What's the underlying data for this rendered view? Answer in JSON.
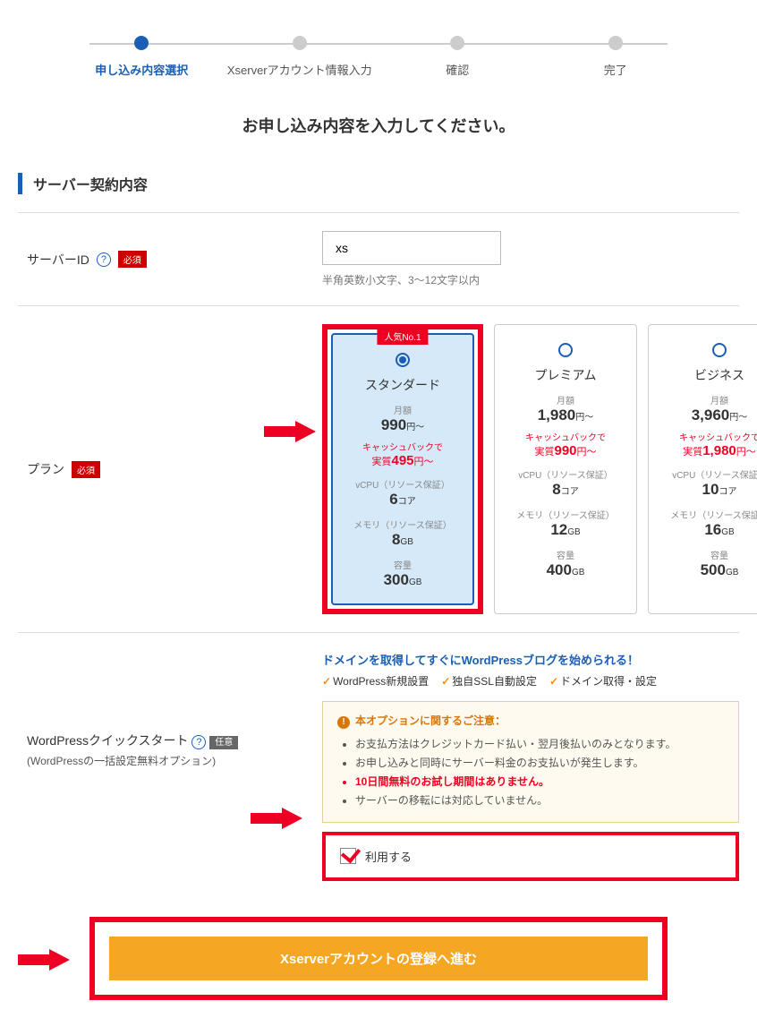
{
  "stepper": {
    "steps": [
      {
        "label": "申し込み内容選択",
        "active": true
      },
      {
        "label": "Xserverアカウント情報入力",
        "active": false
      },
      {
        "label": "確認",
        "active": false
      },
      {
        "label": "完了",
        "active": false
      }
    ]
  },
  "page_subtitle": "お申し込み内容を入力してください。",
  "section_title": "サーバー契約内容",
  "server_id": {
    "label": "サーバーID",
    "badge": "必須",
    "value": "xs",
    "hint": "半角英数小文字、3～12文字以内"
  },
  "plan": {
    "label": "プラン",
    "badge": "必須",
    "popular_badge": "人気No.1",
    "plans": [
      {
        "name": "スタンダード",
        "monthly_label": "月額",
        "monthly_value": "990",
        "monthly_unit": "円～",
        "cashback_label": "キャッシュバックで",
        "cashback_prefix": "実質",
        "cashback_value": "495",
        "cashback_unit": "円～",
        "cpu_label": "vCPU（リソース保証）",
        "cpu_value": "6",
        "cpu_unit": "コア",
        "mem_label": "メモリ（リソース保証）",
        "mem_value": "8",
        "mem_unit": "GB",
        "disk_label": "容量",
        "disk_value": "300",
        "disk_unit": "GB",
        "selected": true
      },
      {
        "name": "プレミアム",
        "monthly_label": "月額",
        "monthly_value": "1,980",
        "monthly_unit": "円～",
        "cashback_label": "キャッシュバックで",
        "cashback_prefix": "実質",
        "cashback_value": "990",
        "cashback_unit": "円～",
        "cpu_label": "vCPU（リソース保証）",
        "cpu_value": "8",
        "cpu_unit": "コア",
        "mem_label": "メモリ（リソース保証）",
        "mem_value": "12",
        "mem_unit": "GB",
        "disk_label": "容量",
        "disk_value": "400",
        "disk_unit": "GB",
        "selected": false
      },
      {
        "name": "ビジネス",
        "monthly_label": "月額",
        "monthly_value": "3,960",
        "monthly_unit": "円～",
        "cashback_label": "キャッシュバックで",
        "cashback_prefix": "実質",
        "cashback_value": "1,980",
        "cashback_unit": "円～",
        "cpu_label": "vCPU（リソース保証）",
        "cpu_value": "10",
        "cpu_unit": "コア",
        "mem_label": "メモリ（リソース保証）",
        "mem_value": "16",
        "mem_unit": "GB",
        "disk_label": "容量",
        "disk_value": "500",
        "disk_unit": "GB",
        "selected": false
      }
    ]
  },
  "quickstart": {
    "label": "WordPressクイックスタート",
    "sublabel": "(WordPressの一括設定無料オプション)",
    "badge": "任意",
    "intro": "ドメインを取得してすぐにWordPressブログを始められる！",
    "features": [
      "WordPress新規設置",
      "独自SSL自動設定",
      "ドメイン取得・設定"
    ],
    "notice_title": "本オプションに関するご注意：",
    "notices": [
      {
        "text": "お支払方法はクレジットカード払い・翌月後払いのみとなります。",
        "red": false
      },
      {
        "text": "お申し込みと同時にサーバー料金のお支払いが発生します。",
        "red": false
      },
      {
        "text": "10日間無料のお試し期間はありません。",
        "red": true
      },
      {
        "text": "サーバーの移転には対応していません。",
        "red": false
      }
    ],
    "checkbox_label": "利用する"
  },
  "submit_label": "Xserverアカウントの登録へ進む"
}
